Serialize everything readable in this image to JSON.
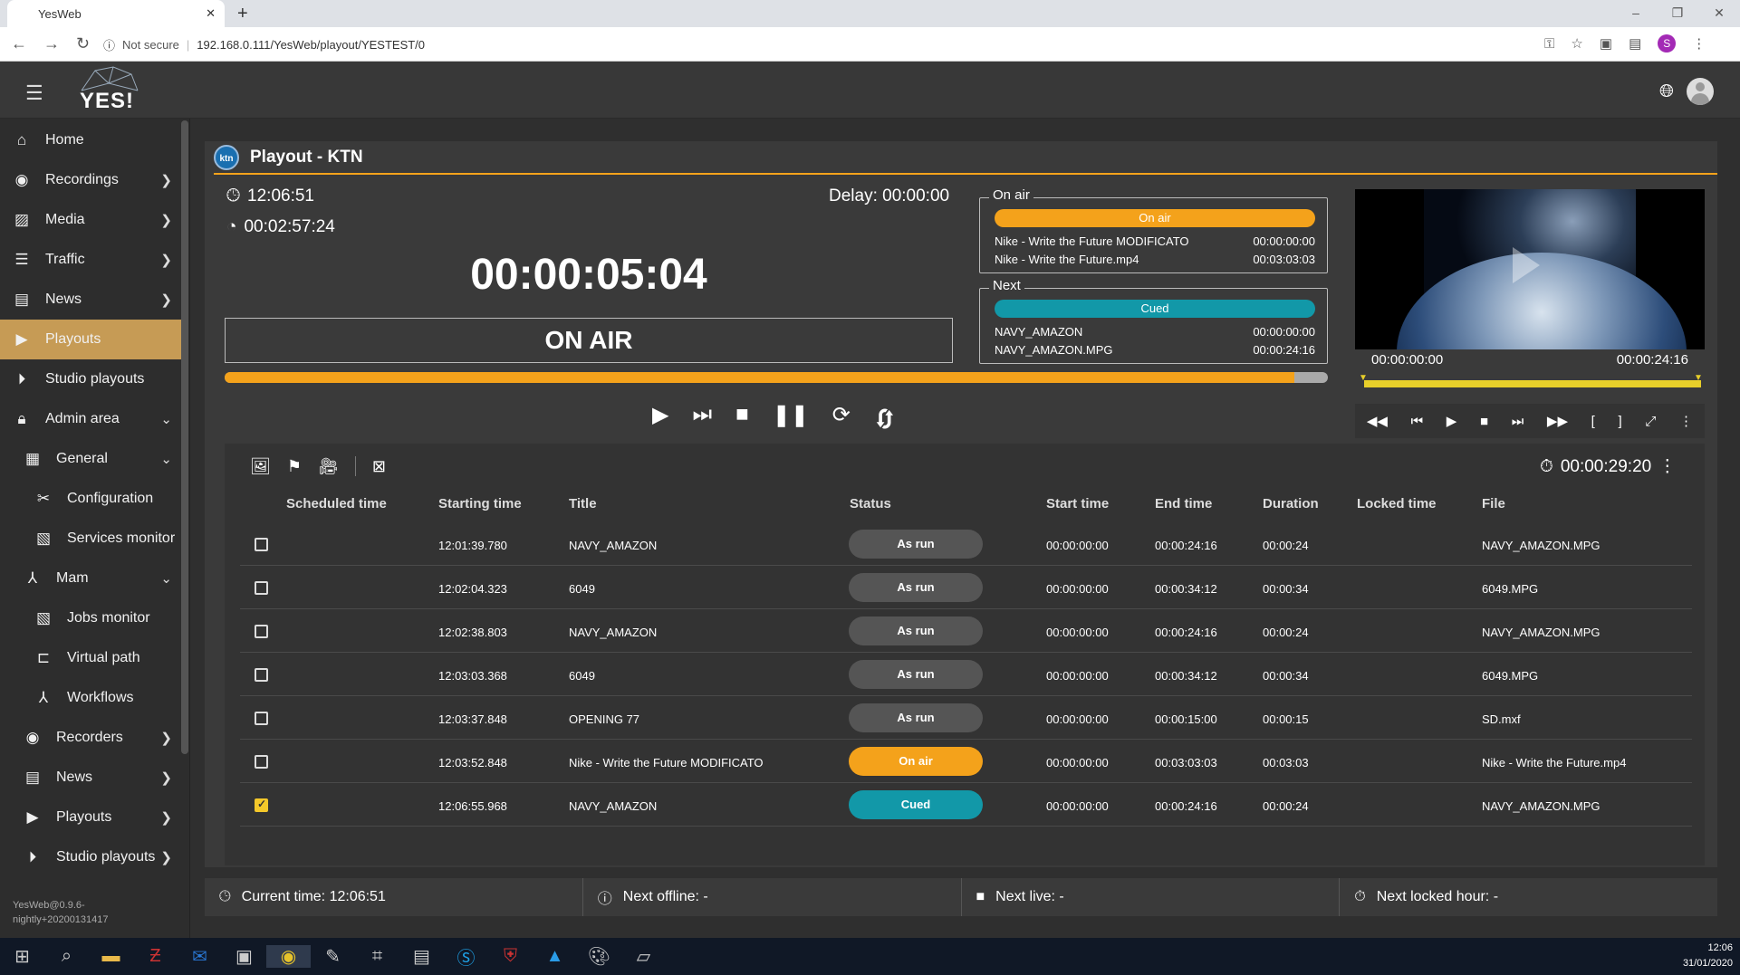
{
  "browser": {
    "tab_title": "YesWeb",
    "security_label": "Not secure",
    "url": "192.168.0.111/YesWeb/playout/YESTEST/0",
    "profile_initial": "S"
  },
  "app": {
    "logo_text": "YES!"
  },
  "sidebar": {
    "items": [
      {
        "label": "Home",
        "icon": "home-icon"
      },
      {
        "label": "Recordings",
        "icon": "record-icon"
      },
      {
        "label": "Media",
        "icon": "image-icon"
      },
      {
        "label": "Traffic",
        "icon": "list-icon"
      },
      {
        "label": "News",
        "icon": "news-icon"
      },
      {
        "label": "Playouts",
        "icon": "play-box-icon"
      },
      {
        "label": "Studio playouts",
        "icon": "play-circle-icon"
      },
      {
        "label": "Admin area",
        "icon": "lock-icon"
      },
      {
        "label": "General",
        "icon": "grid-icon"
      },
      {
        "label": "Configuration",
        "icon": "tools-icon"
      },
      {
        "label": "Services monitor",
        "icon": "monitor-icon"
      },
      {
        "label": "Mam",
        "icon": "workflow-icon"
      },
      {
        "label": "Jobs monitor",
        "icon": "jobs-icon"
      },
      {
        "label": "Virtual path",
        "icon": "tree-icon"
      },
      {
        "label": "Workflows",
        "icon": "workflow-icon"
      },
      {
        "label": "Recorders",
        "icon": "record-icon"
      },
      {
        "label": "News",
        "icon": "news-icon"
      },
      {
        "label": "Playouts",
        "icon": "play-box-icon"
      },
      {
        "label": "Studio playouts",
        "icon": "play-circle-icon"
      }
    ],
    "version": "YesWeb@0.9.6-nightly+20200131417"
  },
  "playout": {
    "channel_logo": "ktn",
    "title": "Playout - KTN",
    "clock": "12:06:51",
    "remaining": "00:02:57:24",
    "delay": "Delay: 00:00:00",
    "countdown": "00:00:05:04",
    "state": "ON AIR",
    "progress_percent": 97
  },
  "onair": {
    "legend": "On air",
    "badge": "On air",
    "rows": [
      {
        "name": "Nike - Write the Future MODIFICATO",
        "tc": "00:00:00:00"
      },
      {
        "name": "Nike - Write the Future.mp4",
        "tc": "00:03:03:03"
      }
    ]
  },
  "next": {
    "legend": "Next",
    "badge": "Cued",
    "rows": [
      {
        "name": "NAVY_AMAZON",
        "tc": "00:00:00:00"
      },
      {
        "name": "NAVY_AMAZON.MPG",
        "tc": "00:00:24:16"
      }
    ]
  },
  "preview": {
    "tc_in": "00:00:00:00",
    "tc_out": "00:00:24:16"
  },
  "playlist": {
    "total_duration": "00:00:29:20",
    "columns": [
      "Scheduled time",
      "Starting time",
      "Title",
      "Status",
      "Start time",
      "End time",
      "Duration",
      "Locked time",
      "File"
    ],
    "rows": [
      {
        "sched": "",
        "start": "12:01:39.780",
        "title": "NAVY_AMAZON",
        "status": "As run",
        "tin": "00:00:00:00",
        "tout": "00:00:24:16",
        "dur": "00:00:24",
        "locked": "",
        "file": "NAVY_AMAZON.MPG",
        "checked": false
      },
      {
        "sched": "",
        "start": "12:02:04.323",
        "title": "6049",
        "status": "As run",
        "tin": "00:00:00:00",
        "tout": "00:00:34:12",
        "dur": "00:00:34",
        "locked": "",
        "file": "6049.MPG",
        "checked": false
      },
      {
        "sched": "",
        "start": "12:02:38.803",
        "title": "NAVY_AMAZON",
        "status": "As run",
        "tin": "00:00:00:00",
        "tout": "00:00:24:16",
        "dur": "00:00:24",
        "locked": "",
        "file": "NAVY_AMAZON.MPG",
        "checked": false
      },
      {
        "sched": "",
        "start": "12:03:03.368",
        "title": "6049",
        "status": "As run",
        "tin": "00:00:00:00",
        "tout": "00:00:34:12",
        "dur": "00:00:34",
        "locked": "",
        "file": "6049.MPG",
        "checked": false
      },
      {
        "sched": "",
        "start": "12:03:37.848",
        "title": "OPENING 77",
        "status": "As run",
        "tin": "00:00:00:00",
        "tout": "00:00:15:00",
        "dur": "00:00:15",
        "locked": "",
        "file": "SD.mxf",
        "checked": false
      },
      {
        "sched": "",
        "start": "12:03:52.848",
        "title": "Nike - Write the Future MODIFICATO",
        "status": "On air",
        "tin": "00:00:00:00",
        "tout": "00:03:03:03",
        "dur": "00:03:03",
        "locked": "",
        "file": "Nike - Write the Future.mp4",
        "checked": false
      },
      {
        "sched": "",
        "start": "12:06:55.968",
        "title": "NAVY_AMAZON",
        "status": "Cued",
        "tin": "00:00:00:00",
        "tout": "00:00:24:16",
        "dur": "00:00:24",
        "locked": "",
        "file": "NAVY_AMAZON.MPG",
        "checked": true
      }
    ]
  },
  "footer": {
    "current_time": "Current time: 12:06:51",
    "next_offline": "Next offline: -",
    "next_live": "Next live: -",
    "next_locked": "Next locked hour: -"
  },
  "taskbar": {
    "time": "12:06",
    "date": "31/01/2020"
  },
  "colors": {
    "accent": "#f4a21b",
    "active_nav": "#c69b55",
    "cued": "#1298a8",
    "onair": "#f4a21b",
    "asrun": "#555555"
  }
}
